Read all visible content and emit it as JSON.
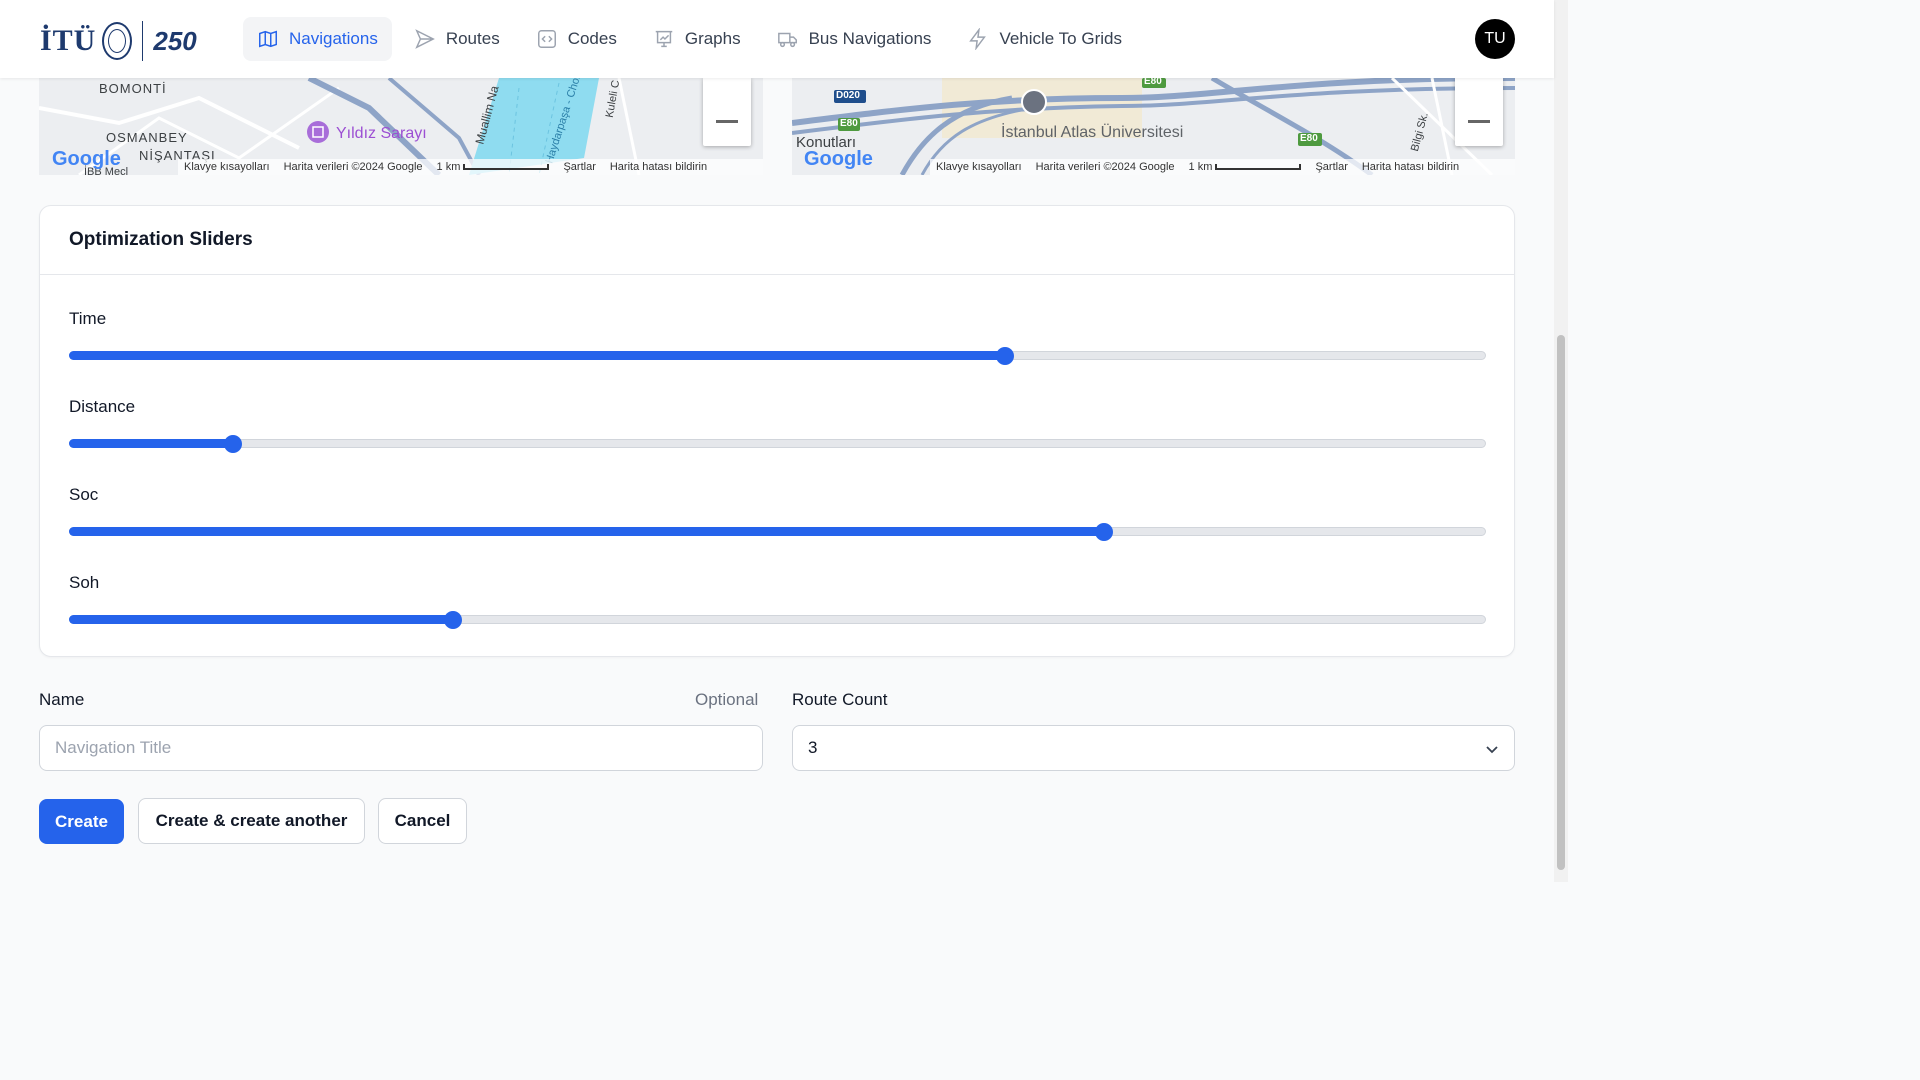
{
  "header": {
    "logo_text": "İTÜ",
    "logo_year": "250",
    "nav": [
      {
        "label": "Navigations",
        "icon": "map-icon",
        "active": true
      },
      {
        "label": "Routes",
        "icon": "send-icon",
        "active": false
      },
      {
        "label": "Codes",
        "icon": "code-icon",
        "active": false
      },
      {
        "label": "Graphs",
        "icon": "chart-icon",
        "active": false
      },
      {
        "label": "Bus Navigations",
        "icon": "truck-icon",
        "active": false
      },
      {
        "label": "Vehicle To Grids",
        "icon": "bolt-icon",
        "active": false
      }
    ],
    "avatar_initials": "TU"
  },
  "maps": {
    "left": {
      "labels": [
        "BOMONTİ",
        "OSMANBEY",
        "NİŞANTAŞI",
        "Yıldız Sarayı",
        "Muallim Na",
        "Haydarpaşa - Chor",
        "Kuleli C",
        "İBB Mecl"
      ],
      "attribution": [
        "Klavye kısayolları",
        "Harita verileri ©2024 Google",
        "1 km",
        "Şartlar",
        "Harita hatası bildirin"
      ]
    },
    "right": {
      "labels": [
        "D020",
        "E80",
        "E80",
        "E80",
        "Konutları",
        "İstanbul Atlas Üniversitesi",
        "Bilgi Sk."
      ],
      "attribution": [
        "Klavye kısayolları",
        "Harita verileri ©2024 Google",
        "1 km",
        "Şartlar",
        "Harita hatası bildirin"
      ]
    },
    "google_logo": "Google"
  },
  "optimization": {
    "title": "Optimization Sliders",
    "sliders": [
      {
        "label": "Time",
        "value": 0.66
      },
      {
        "label": "Distance",
        "value": 0.115
      },
      {
        "label": "Soc",
        "value": 0.73
      },
      {
        "label": "Soh",
        "value": 0.27
      }
    ]
  },
  "form": {
    "name_label": "Name",
    "name_optional": "Optional",
    "name_placeholder": "Navigation Title",
    "name_value": "",
    "route_count_label": "Route Count",
    "route_count_value": "3"
  },
  "actions": {
    "create": "Create",
    "create_another": "Create & create another",
    "cancel": "Cancel"
  },
  "colors": {
    "primary": "#2563eb",
    "avatar_bg": "#000000"
  }
}
